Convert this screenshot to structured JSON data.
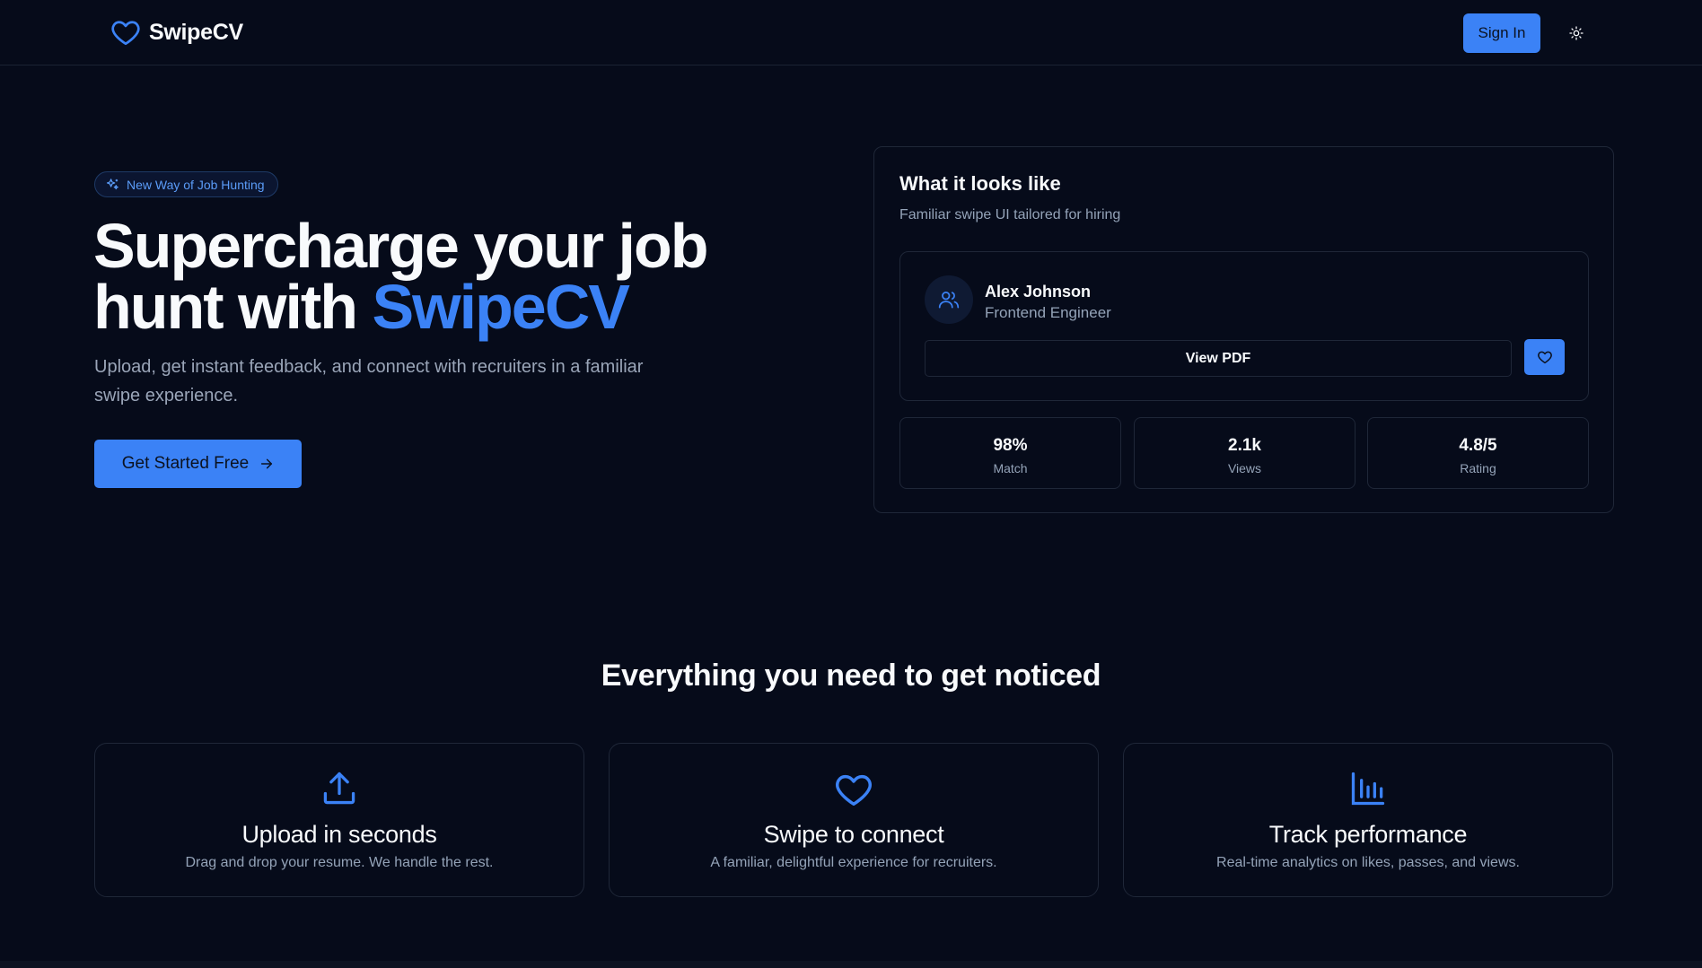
{
  "header": {
    "brand_name": "SwipeCV",
    "signin_label": "Sign In",
    "theme_icon": "sun-icon"
  },
  "hero": {
    "badge": "New Way of Job Hunting",
    "title_part1": "Supercharge your job hunt with ",
    "title_accent": "SwipeCV",
    "subtitle": "Upload, get instant feedback, and connect with recruiters in a familiar swipe experience.",
    "cta_label": "Get Started Free"
  },
  "preview": {
    "title": "What it looks like",
    "subtitle": "Familiar swipe UI tailored for hiring",
    "profile": {
      "name": "Alex Johnson",
      "role": "Frontend Engineer",
      "view_pdf_label": "View PDF"
    },
    "stats": [
      {
        "value": "98%",
        "label": "Match"
      },
      {
        "value": "2.1k",
        "label": "Views"
      },
      {
        "value": "4.8/5",
        "label": "Rating"
      }
    ]
  },
  "features": {
    "title": "Everything you need to get noticed",
    "items": [
      {
        "title": "Upload in seconds",
        "description": "Drag and drop your resume. We handle the rest.",
        "icon": "upload-icon"
      },
      {
        "title": "Swipe to connect",
        "description": "A familiar, delightful experience for recruiters.",
        "icon": "heart-icon"
      },
      {
        "title": "Track performance",
        "description": "Real-time analytics on likes, passes, and views.",
        "icon": "bar-chart-icon"
      }
    ]
  },
  "colors": {
    "background": "#060b1a",
    "accent": "#3b82f6",
    "border": "#1f2738",
    "muted_text": "#94a3b8"
  }
}
